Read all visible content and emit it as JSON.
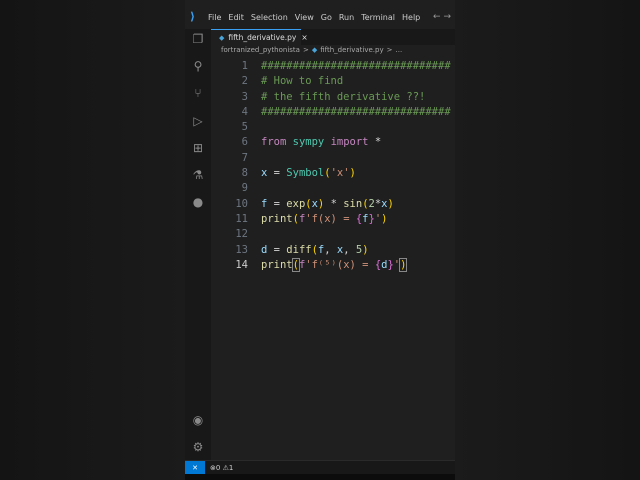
{
  "menu": [
    "File",
    "Edit",
    "Selection",
    "View",
    "Go",
    "Run",
    "Terminal",
    "Help"
  ],
  "tab": {
    "label": "fifth_derivative.py",
    "close": "×"
  },
  "breadcrumb": {
    "folder": "fortranized_pythonista",
    "sep": ">",
    "file": "fifth_derivative.py",
    "more": "..."
  },
  "current_line": 14,
  "code": [
    [
      [
        "##############################",
        "c"
      ]
    ],
    [
      [
        "# How to find",
        "c"
      ]
    ],
    [
      [
        "# the fifth derivative ??!",
        "c"
      ]
    ],
    [
      [
        "##############################",
        "c"
      ]
    ],
    [],
    [
      [
        "from",
        "k"
      ],
      [
        " ",
        "o"
      ],
      [
        "sympy",
        "mod"
      ],
      [
        " ",
        "o"
      ],
      [
        "import",
        "k"
      ],
      [
        " *",
        "o"
      ]
    ],
    [],
    [
      [
        "x",
        "v"
      ],
      [
        " = ",
        "o"
      ],
      [
        "Symbol",
        "mod"
      ],
      [
        "(",
        "b1"
      ],
      [
        "'x'",
        "s"
      ],
      [
        ")",
        "b1"
      ]
    ],
    [],
    [
      [
        "f",
        "v"
      ],
      [
        " = ",
        "o"
      ],
      [
        "exp",
        "f"
      ],
      [
        "(",
        "b1"
      ],
      [
        "x",
        "v"
      ],
      [
        ")",
        "b1"
      ],
      [
        " * ",
        "o"
      ],
      [
        "sin",
        "f"
      ],
      [
        "(",
        "b1"
      ],
      [
        "2",
        "n"
      ],
      [
        "*",
        "o"
      ],
      [
        "x",
        "v"
      ],
      [
        ")",
        "b1"
      ]
    ],
    [
      [
        "print",
        "f"
      ],
      [
        "(",
        "b1"
      ],
      [
        "f",
        "k"
      ],
      [
        "'f(x) = ",
        "s"
      ],
      [
        "{",
        "b2"
      ],
      [
        "f",
        "v"
      ],
      [
        "}",
        "b2"
      ],
      [
        "'",
        "s"
      ],
      [
        ")",
        "b1"
      ]
    ],
    [],
    [
      [
        "d",
        "v"
      ],
      [
        " = ",
        "o"
      ],
      [
        "diff",
        "f"
      ],
      [
        "(",
        "b1"
      ],
      [
        "f",
        "v"
      ],
      [
        ", ",
        "o"
      ],
      [
        "x",
        "v"
      ],
      [
        ", ",
        "o"
      ],
      [
        "5",
        "n"
      ],
      [
        ")",
        "b1"
      ]
    ],
    [
      [
        "print",
        "f"
      ],
      [
        "(",
        "b1 hl"
      ],
      [
        "f",
        "k"
      ],
      [
        "'f⁽⁵⁾(x) = ",
        "s"
      ],
      [
        "{",
        "b2"
      ],
      [
        "d",
        "v"
      ],
      [
        "}",
        "b2"
      ],
      [
        "'",
        "s"
      ],
      [
        ")",
        "b1 hl"
      ]
    ]
  ],
  "status": {
    "errors": "0",
    "warnings": "1"
  }
}
